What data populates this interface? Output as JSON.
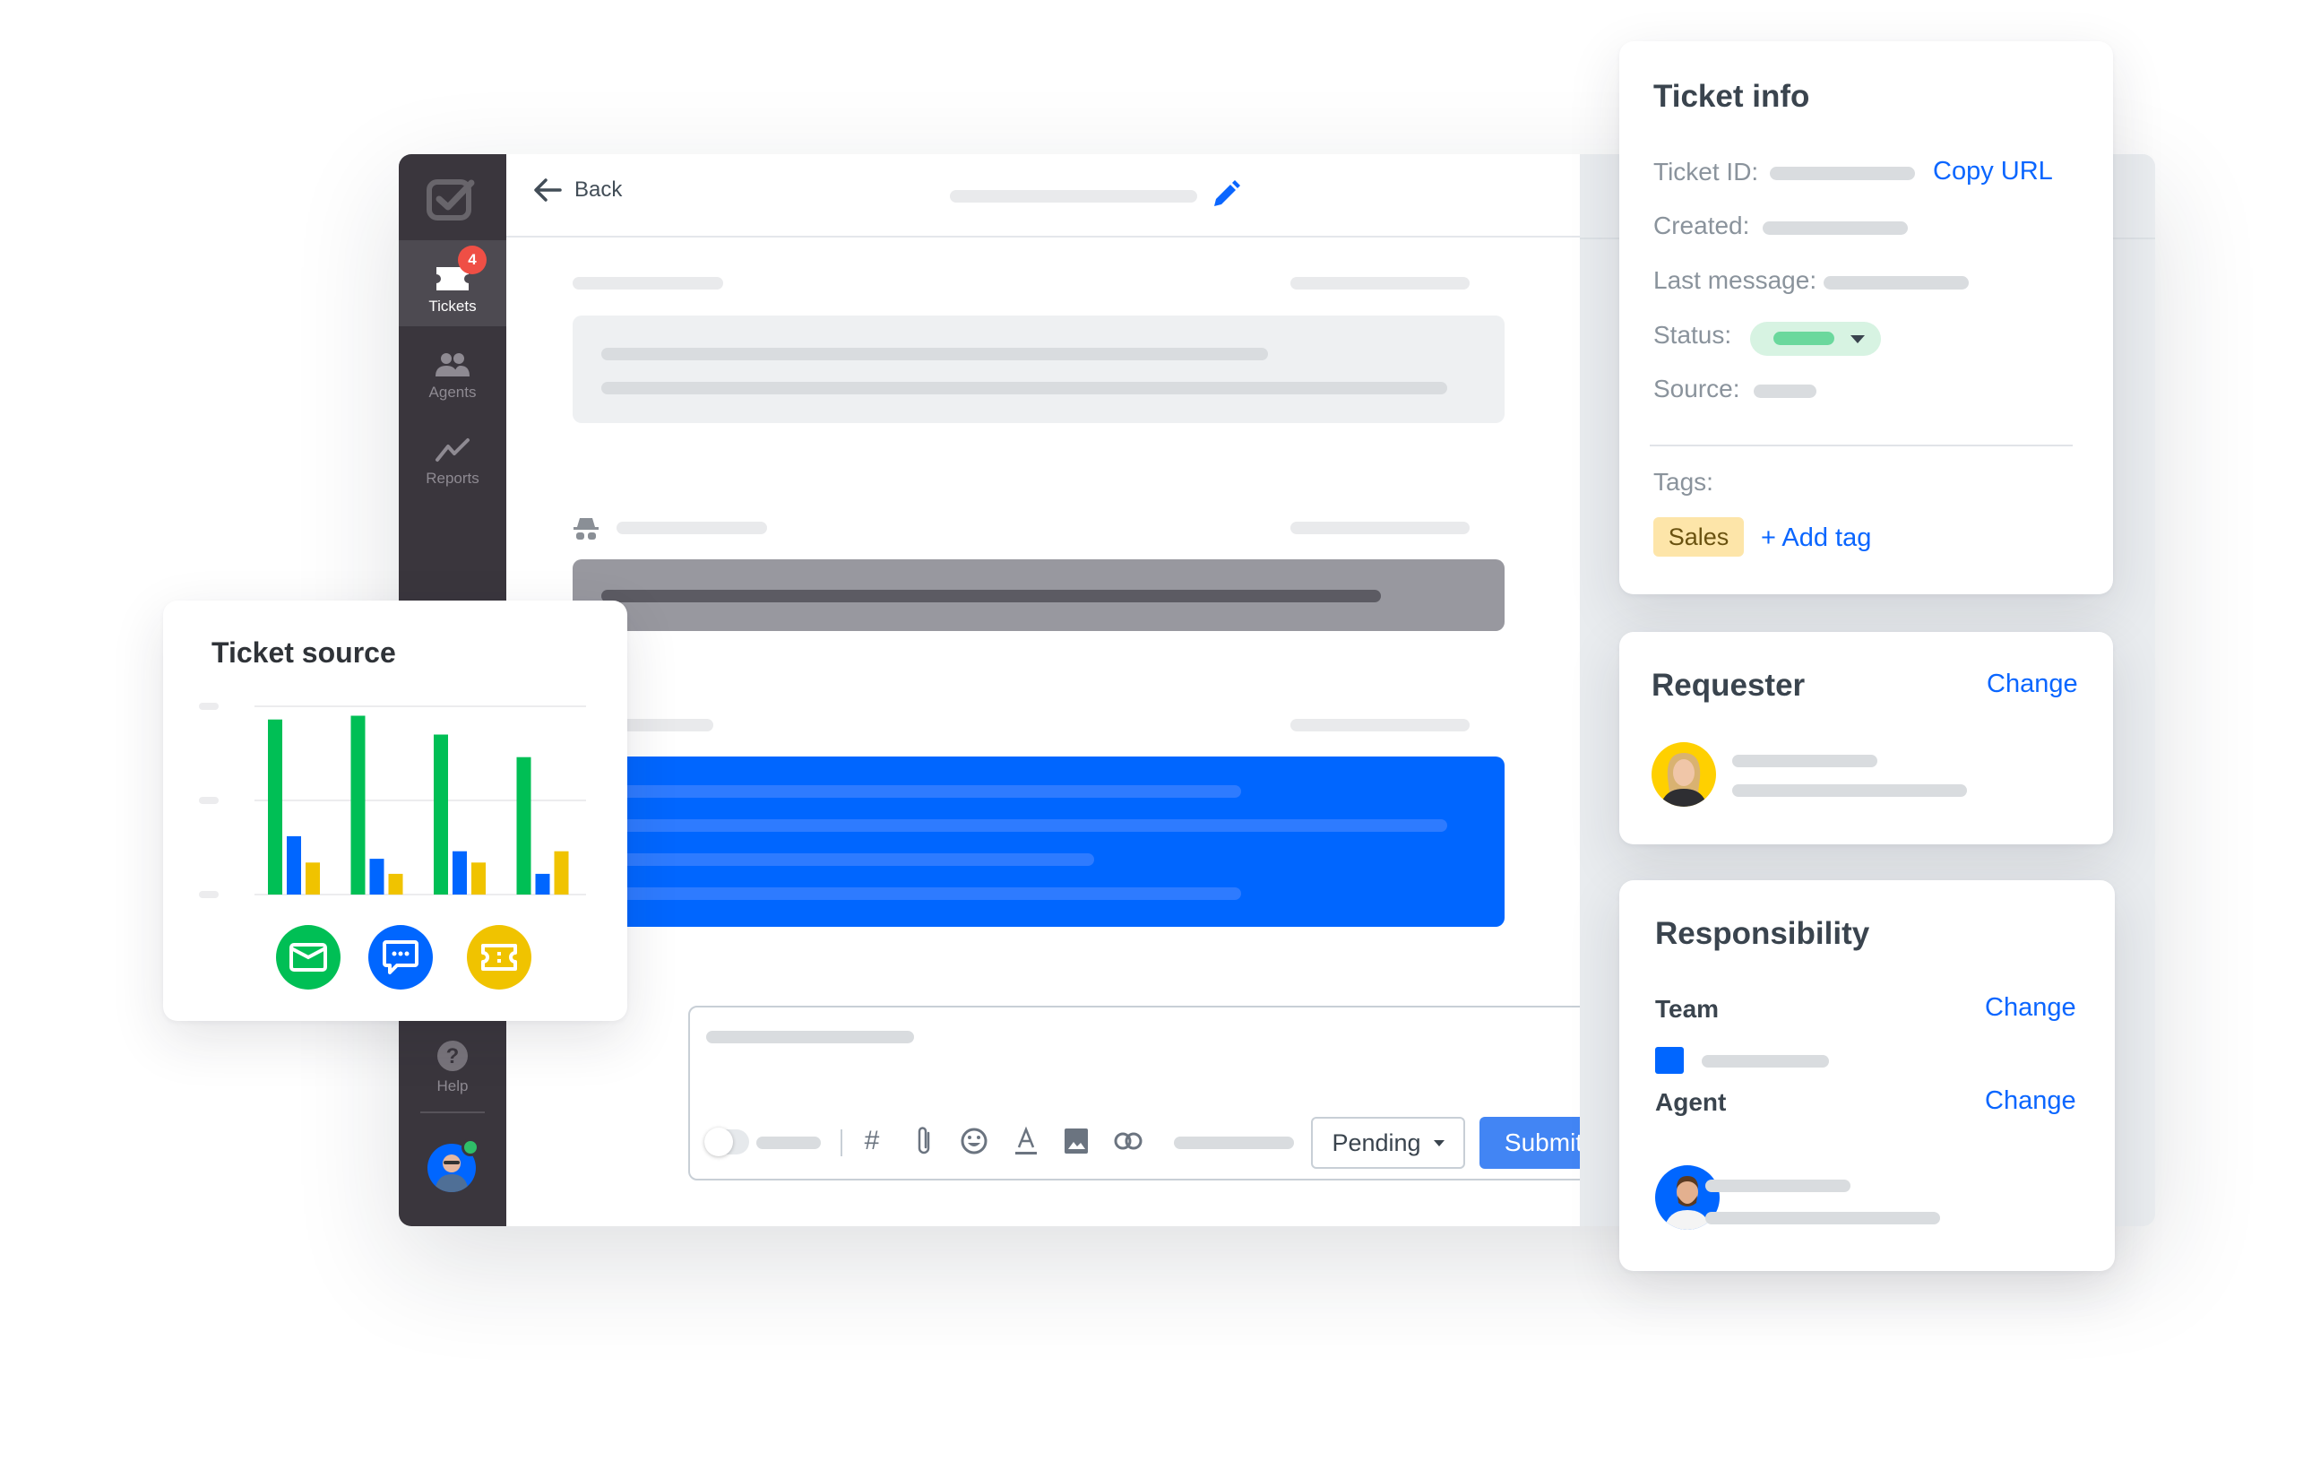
{
  "sidebar": {
    "logo": "checkbox-logo",
    "items": [
      {
        "label": "Tickets",
        "icon": "ticket-icon",
        "badge": "4",
        "active": true
      },
      {
        "label": "Agents",
        "icon": "agents-icon"
      },
      {
        "label": "Reports",
        "icon": "reports-icon"
      }
    ],
    "help": {
      "label": "Help",
      "icon": "help-icon"
    },
    "user_status": "online"
  },
  "header": {
    "back_label": "Back",
    "edit_icon": "pencil-icon"
  },
  "composer": {
    "toolbar_icons": [
      "hashtag-icon",
      "paperclip-icon",
      "emoji-icon",
      "text-color-icon",
      "image-icon",
      "link-icon"
    ],
    "status_select": "Pending",
    "submit_label": "Submit"
  },
  "ticket_info": {
    "title": "Ticket info",
    "ticket_id_label": "Ticket ID:",
    "copy_url_label": "Copy URL",
    "created_label": "Created:",
    "last_message_label": "Last message:",
    "status_label": "Status:",
    "source_label": "Source:",
    "tags_label": "Tags:",
    "tags": [
      "Sales"
    ],
    "add_tag_label": "+ Add tag"
  },
  "requester": {
    "title": "Requester",
    "change_label": "Change"
  },
  "responsibility": {
    "title": "Responsibility",
    "team_label": "Team",
    "team_change_label": "Change",
    "agent_label": "Agent",
    "agent_change_label": "Change"
  },
  "ticket_source": {
    "title": "Ticket source",
    "legend": [
      {
        "name": "Email",
        "icon": "envelope-icon",
        "color": "#00bf55"
      },
      {
        "name": "Chat",
        "icon": "chat-bubble-icon",
        "color": "#0066ff"
      },
      {
        "name": "Ticket",
        "icon": "ticket-icon",
        "color": "#f0c300"
      }
    ]
  },
  "colors": {
    "accent": "#0a66ff",
    "sidebar": "#3a363d",
    "badge": "#ef4f45",
    "submit": "#4285f4",
    "agent_message": "#0066ff",
    "private_note": "#98989f"
  },
  "chart_data": {
    "type": "bar",
    "title": "Ticket source",
    "categories": [
      "",
      "",
      "",
      ""
    ],
    "series": [
      {
        "name": "Email",
        "color": "#00bf55",
        "values": [
          93,
          95,
          85,
          73
        ]
      },
      {
        "name": "Chat",
        "color": "#0066ff",
        "values": [
          31,
          19,
          23,
          11
        ]
      },
      {
        "name": "Ticket",
        "color": "#f0c300",
        "values": [
          17,
          11,
          17,
          23
        ]
      }
    ],
    "ylim": [
      0,
      100
    ],
    "yticks": [
      0,
      50,
      100
    ],
    "grid": true,
    "xlabel": "",
    "ylabel": "",
    "legend": "bottom"
  }
}
